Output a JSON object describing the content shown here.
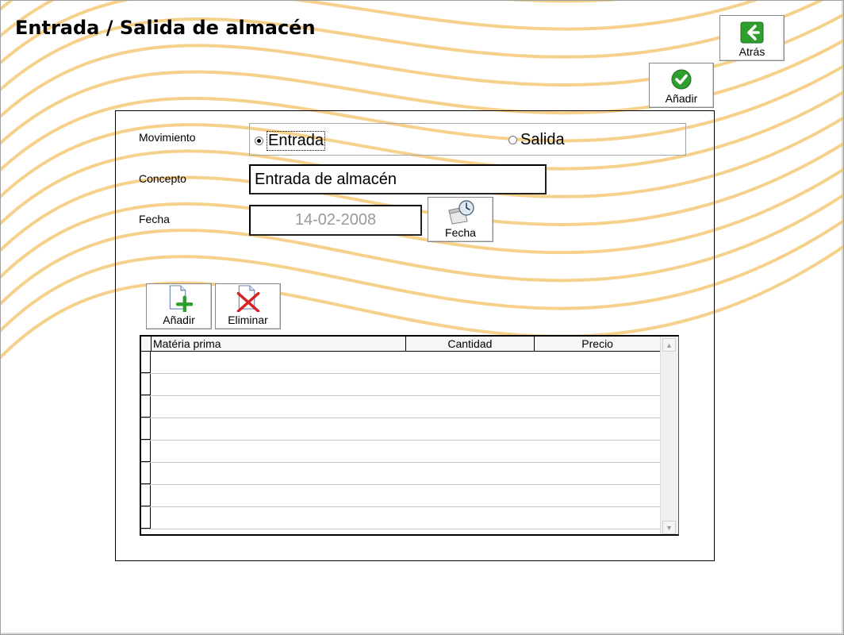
{
  "window": {
    "title": "Entrada / Salida de almacén"
  },
  "toolbar": {
    "back_label": "Atrás",
    "add_label": "Añadir"
  },
  "form": {
    "movement_label": "Movimiento",
    "movement_options": [
      {
        "label": "Entrada",
        "checked": true
      },
      {
        "label": "Salida",
        "checked": false
      }
    ],
    "concept_label": "Concepto",
    "concept_value": "Entrada de almacén",
    "date_label": "Fecha",
    "date_value": "14-02-2008",
    "date_button_label": "Fecha"
  },
  "lines": {
    "add_label": "Añadir",
    "delete_label": "Eliminar",
    "columns": [
      "Matéria prima",
      "Cantidad",
      "Precio"
    ],
    "row_count": 8
  },
  "colors": {
    "swirl": "#f3c165",
    "accent_green": "#2e9e2e",
    "delete_red": "#d82020"
  }
}
